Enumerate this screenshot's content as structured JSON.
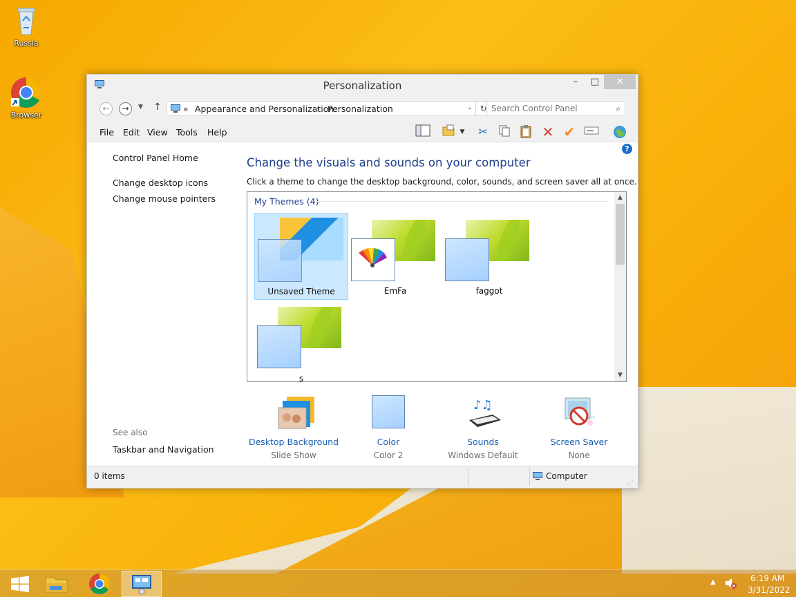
{
  "desktop": {
    "icons": [
      {
        "label": "Russia",
        "icon": "recycle-bin-icon"
      },
      {
        "label": "Browser",
        "icon": "chrome-icon"
      }
    ]
  },
  "window": {
    "title": "Personalization",
    "address": {
      "prefix": "«",
      "crumbs": [
        "Appearance and Personalization",
        "Personalization"
      ],
      "separator": "›"
    },
    "search_placeholder": "Search Control Panel",
    "menu": [
      "File",
      "Edit",
      "View",
      "Tools",
      "Help"
    ],
    "left_pane": {
      "links": [
        "Control Panel Home",
        "Change desktop icons",
        "Change mouse pointers"
      ],
      "see_also": "See also",
      "see_also_links": [
        "Taskbar and Navigation"
      ]
    },
    "main": {
      "title": "Change the visuals and sounds on your computer",
      "description": "Click a theme to change the desktop background, color, sounds, and screen saver all at once.",
      "group_header": "My Themes (4)",
      "themes": [
        {
          "label": "Unsaved Theme",
          "selected": true
        },
        {
          "label": "EmFa",
          "selected": false
        },
        {
          "label": "faggot",
          "selected": false
        },
        {
          "label": "s",
          "selected": false
        }
      ]
    },
    "bottom_items": [
      {
        "name": "Desktop Background",
        "value": "Slide Show"
      },
      {
        "name": "Color",
        "value": "Color 2"
      },
      {
        "name": "Sounds",
        "value": "Windows Default"
      },
      {
        "name": "Screen Saver",
        "value": "None"
      }
    ],
    "status": {
      "left": "0 items",
      "right": "Computer"
    }
  },
  "taskbar": {
    "time": "6:19 AM",
    "date": "3/31/2022"
  },
  "colors": {
    "accent_title": "#1e3f8c",
    "link": "#1a5fb4",
    "selection": "#cce8ff"
  }
}
